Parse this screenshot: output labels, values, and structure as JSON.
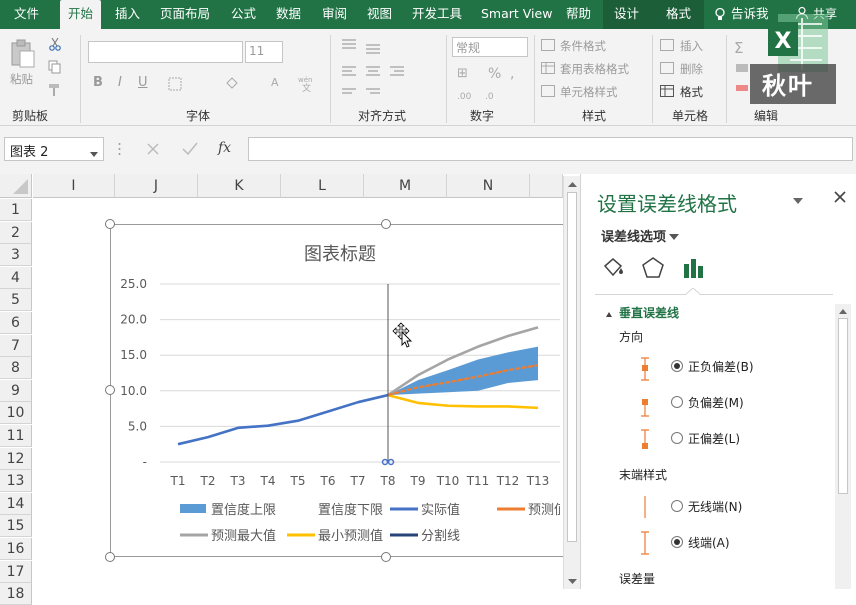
{
  "menu": {
    "tabs": [
      "文件",
      "开始",
      "插入",
      "页面布局",
      "公式",
      "数据",
      "审阅",
      "视图",
      "开发工具",
      "Smart View",
      "帮助",
      "设计",
      "格式"
    ],
    "active": "开始",
    "tell_me": "告诉我",
    "share": "共享"
  },
  "logo": {
    "text": "秋叶"
  },
  "ribbon": {
    "clipboard": {
      "paste": "粘贴",
      "label": "剪贴板"
    },
    "font": {
      "size": "11",
      "bold": "B",
      "italic": "I",
      "underline": "U",
      "label": "字体"
    },
    "alignment": {
      "label": "对齐方式"
    },
    "number": {
      "format": "常规",
      "label": "数字"
    },
    "styles": {
      "conditional": "条件格式",
      "table": "套用表格格式",
      "cell": "单元格样式",
      "label": "样式"
    },
    "cells": {
      "insert": "插入",
      "delete": "删除",
      "format": "格式",
      "label": "单元格"
    },
    "editing": {
      "label": "编辑"
    }
  },
  "formula_bar": {
    "name_box": "图表 2",
    "fx": "fx"
  },
  "sheet": {
    "columns": [
      "I",
      "J",
      "K",
      "L",
      "M",
      "N"
    ],
    "rows": [
      "1",
      "2",
      "3",
      "4",
      "5",
      "6",
      "7",
      "8",
      "9",
      "10",
      "11",
      "12",
      "13",
      "14",
      "15",
      "16",
      "17",
      "18"
    ]
  },
  "chart_data": {
    "type": "line",
    "title": "图表标题",
    "categories": [
      "T1",
      "T2",
      "T3",
      "T4",
      "T5",
      "T6",
      "T7",
      "T8",
      "T9",
      "T10",
      "T11",
      "T12",
      "T13"
    ],
    "y_ticks": [
      "-",
      "5.0",
      "10.0",
      "15.0",
      "20.0",
      "25.0"
    ],
    "ylim": [
      0,
      25
    ],
    "series": [
      {
        "name": "实际值",
        "color": "#4472c4",
        "values": [
          2.5,
          3.5,
          4.8,
          5.1,
          5.8,
          7.1,
          8.4,
          9.4,
          null,
          null,
          null,
          null,
          null
        ]
      },
      {
        "name": "预测最大值",
        "color": "#a5a5a5",
        "values": [
          null,
          null,
          null,
          null,
          null,
          null,
          null,
          9.4,
          12.2,
          14.4,
          16.2,
          17.7,
          18.9
        ]
      },
      {
        "name": "最小预测值",
        "color": "#ffc000",
        "values": [
          null,
          null,
          null,
          null,
          null,
          null,
          null,
          9.4,
          8.3,
          7.9,
          7.8,
          7.8,
          7.6
        ]
      },
      {
        "name": "预测",
        "color": "#ed7d31",
        "values": [
          null,
          null,
          null,
          null,
          null,
          null,
          null,
          9.4,
          10.5,
          11.2,
          12.0,
          12.9,
          13.6
        ]
      },
      {
        "name": "置信度上限",
        "color": "#5b9bd5",
        "values": [
          null,
          null,
          null,
          null,
          null,
          null,
          null,
          9.4,
          11.5,
          12.9,
          14.4,
          15.4,
          16.2
        ]
      },
      {
        "name": "置信度下限",
        "color": "#5b9bd5",
        "values": [
          null,
          null,
          null,
          null,
          null,
          null,
          null,
          9.4,
          9.6,
          9.8,
          10.0,
          11.1,
          11.5
        ]
      }
    ],
    "legend": [
      "置信度上限",
      "置信度下限",
      "实际值",
      "预测",
      "预测最大值",
      "最小预测值",
      "分割线"
    ],
    "legend_truncated_label": "预测值",
    "legend_position": "bottom",
    "divider_at": "T8"
  },
  "pane": {
    "title": "设置误差线格式",
    "options_dropdown": "误差线选项",
    "section": "垂直误差线",
    "direction_label": "方向",
    "direction_options": [
      {
        "label": "正负偏差(B)",
        "selected": true
      },
      {
        "label": "负偏差(M)",
        "selected": false
      },
      {
        "label": "正偏差(L)",
        "selected": false
      }
    ],
    "end_style_label": "末端样式",
    "end_style_options": [
      {
        "label": "无线端(N)",
        "selected": false
      },
      {
        "label": "线端(A)",
        "selected": true
      }
    ],
    "amount_label": "误差量"
  }
}
